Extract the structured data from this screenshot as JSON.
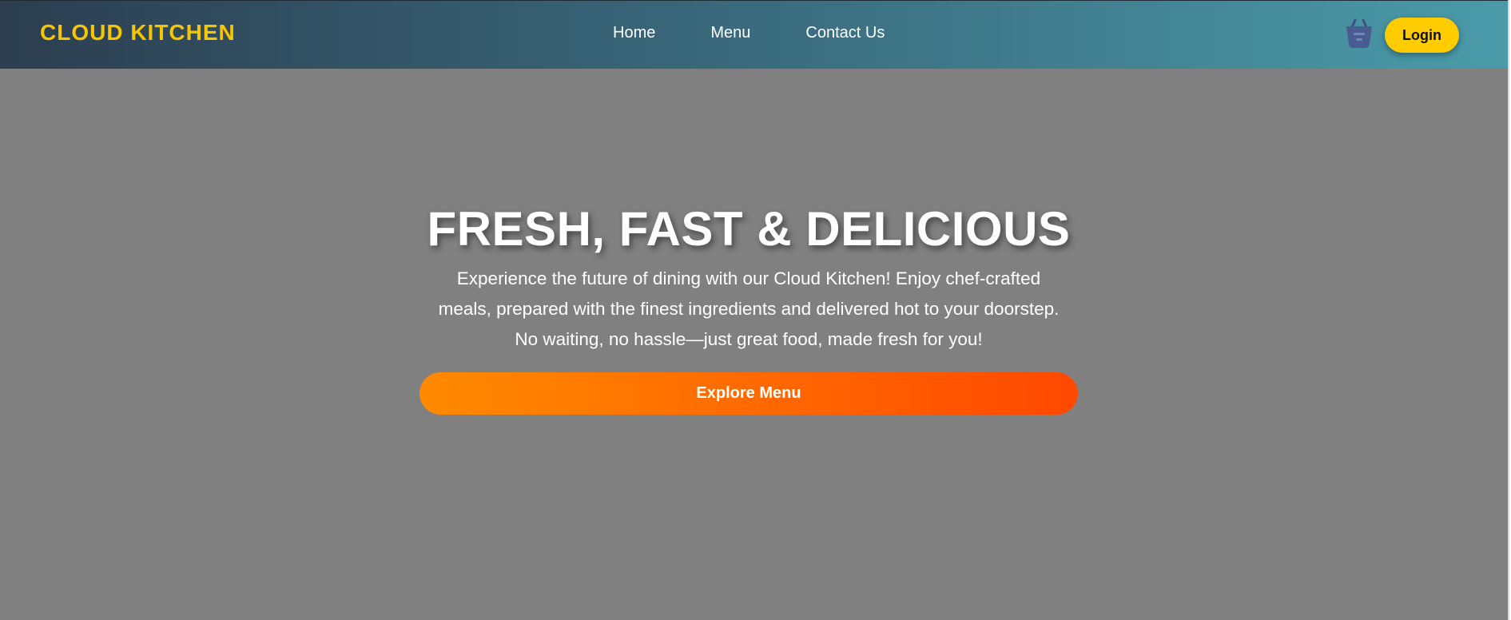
{
  "brand": {
    "name": "CLOUD KITCHEN",
    "color": "#f7c600"
  },
  "nav": {
    "links": [
      {
        "label": "Home"
      },
      {
        "label": "Menu"
      },
      {
        "label": "Contact Us"
      }
    ],
    "cart_icon": "basket-icon",
    "login_label": "Login"
  },
  "hero": {
    "title": "FRESH, FAST & DELICIOUS",
    "text": "Experience the future of dining with our Cloud Kitchen! Enjoy chef-crafted meals, prepared with the finest ingredients and delivered hot to your doorstep. No waiting, no hassle—just great food, made fresh for you!",
    "cta_label": "Explore Menu"
  },
  "colors": {
    "background": "#808080",
    "login_button": "#ffcc00",
    "cta_start": "#ff8a00",
    "cta_end": "#ff4800"
  }
}
